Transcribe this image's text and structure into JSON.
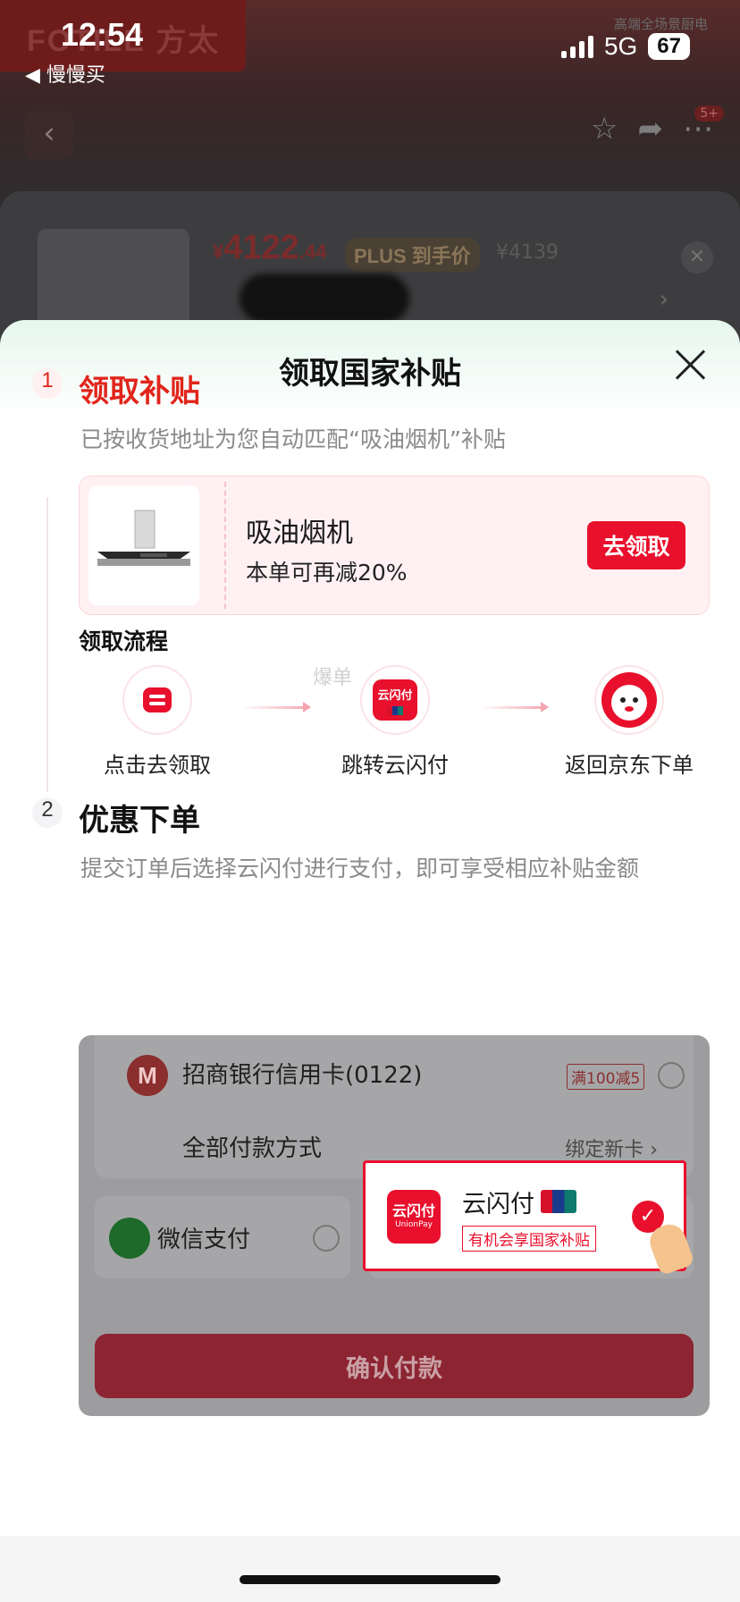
{
  "status_bar": {
    "time": "12:54",
    "back_app": "◀ 慢慢买",
    "network": "5G",
    "battery": "67"
  },
  "background": {
    "brand": "FOTILE 方太",
    "top_right_text": "高端全场景厨电",
    "nav_badge": "5+",
    "product": {
      "price_symbol": "¥",
      "price_main": "4122",
      "price_decimal": ".44",
      "plus_label": "PLUS 到手价",
      "original_price": "¥4139"
    },
    "icons": [
      "back-arrow-icon",
      "star-icon",
      "share-icon",
      "more-icon",
      "close-icon",
      "chevron-right-icon"
    ]
  },
  "sheet": {
    "title": "领取国家补贴",
    "step1": {
      "number": "1",
      "title": "领取补贴",
      "desc": "已按收货地址为您自动匹配“吸油烟机”补贴",
      "subsidy": {
        "product_name": "吸油烟机",
        "discount_text": "本单可再减20%",
        "claim_button": "去领取"
      },
      "flow": {
        "title": "领取流程",
        "steps": [
          {
            "label": "点击去领取",
            "icon": "tap-icon"
          },
          {
            "label": "跳转云闪付",
            "icon": "unionpay-icon"
          },
          {
            "label": "返回京东下单",
            "icon": "jd-mascot-icon"
          }
        ],
        "watermark": "爆单"
      }
    },
    "step2": {
      "number": "2",
      "title": "优惠下单",
      "desc": "提交订单后选择云闪付进行支付，即可享受相应补贴金额",
      "payment": {
        "bank_card": "招商银行信用卡(0122)",
        "bank_promo": "满100减5",
        "all_methods": "全部付款方式",
        "bind_card": "绑定新卡 ›",
        "wechat": "微信支付",
        "unionpay_name": "云闪付",
        "unionpay_logo_text": "云闪付",
        "unionpay_logo_sub": "UnionPay",
        "unionpay_tag": "有机会享国家补贴",
        "confirm_button": "确认付款"
      }
    }
  },
  "colors": {
    "accent_red": "#e8102c",
    "sheet_gradient_top": "#e6f7ee",
    "pink_card": "#fff1f3"
  }
}
